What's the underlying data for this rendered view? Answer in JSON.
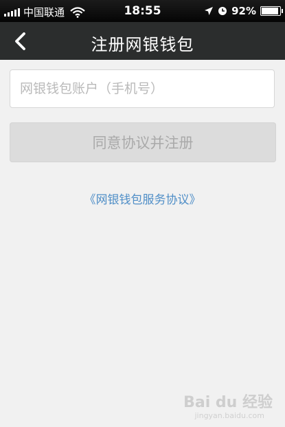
{
  "status_bar": {
    "carrier": "中国联通",
    "time": "18:55",
    "battery_percent": "92%",
    "battery_level": 0.92,
    "icons": [
      "signal-icon",
      "wifi-icon",
      "location-icon",
      "alarm-icon",
      "battery-icon"
    ]
  },
  "navbar": {
    "title": "注册网银钱包",
    "back_icon": "chevron-left-icon"
  },
  "form": {
    "phone_placeholder": "网银钱包账户（手机号）",
    "phone_value": "",
    "register_label": "同意协议并注册"
  },
  "agreement_link": "《网银钱包服务协议》",
  "watermark": {
    "text": "Bai du 经验",
    "url": "jingyan.baidu.com"
  },
  "colors": {
    "navbar_bg": "#2b2d2d",
    "page_bg": "#f1f1f1",
    "link": "#4f8ec7",
    "disabled_button": "#dcdcdc"
  }
}
